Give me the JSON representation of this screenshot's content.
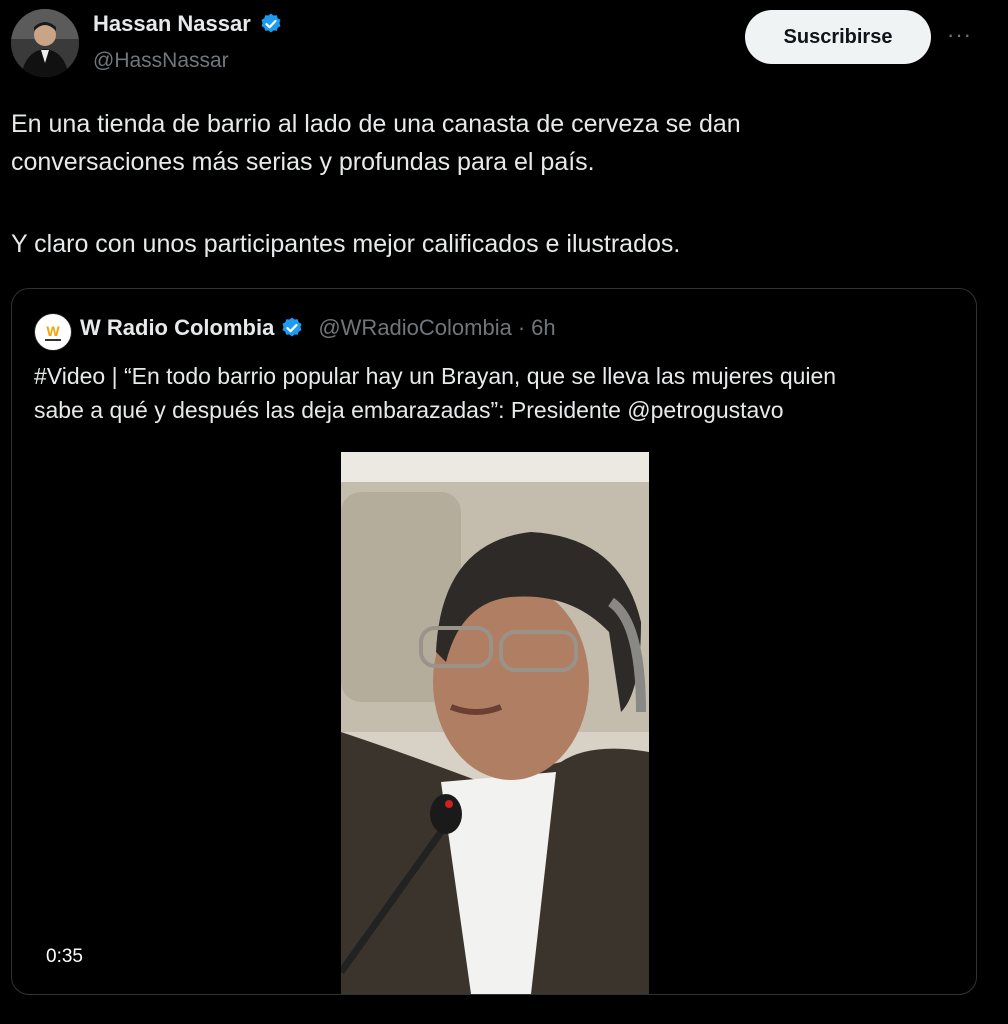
{
  "author": {
    "name": "Hassan Nassar",
    "handle": "@HassNassar",
    "avatar_icon": "profile-photo"
  },
  "actions": {
    "subscribe_label": "Suscribirse",
    "more_label": "···"
  },
  "tweet": {
    "line1": "En una tienda de barrio al lado de una canasta de cerveza se dan",
    "line2": "conversaciones más serias y profundas para el país.",
    "line3": "Y claro con unos participantes mejor calificados e ilustrados."
  },
  "quoted": {
    "name": "W Radio Colombia",
    "handle": "@WRadioColombia",
    "separator": "·",
    "time": "6h",
    "logo_text": "W",
    "line1": "#Video | “En todo barrio popular hay un Brayan, que se lleva las mujeres quien",
    "line2": "sabe a qué y después las deja embarazadas”: Presidente @petrogustavo",
    "video_duration": "0:35"
  },
  "colors": {
    "background": "#000000",
    "verified": "#1d9bf0",
    "secondary_text": "#71767b",
    "button_bg": "#eff3f4"
  }
}
